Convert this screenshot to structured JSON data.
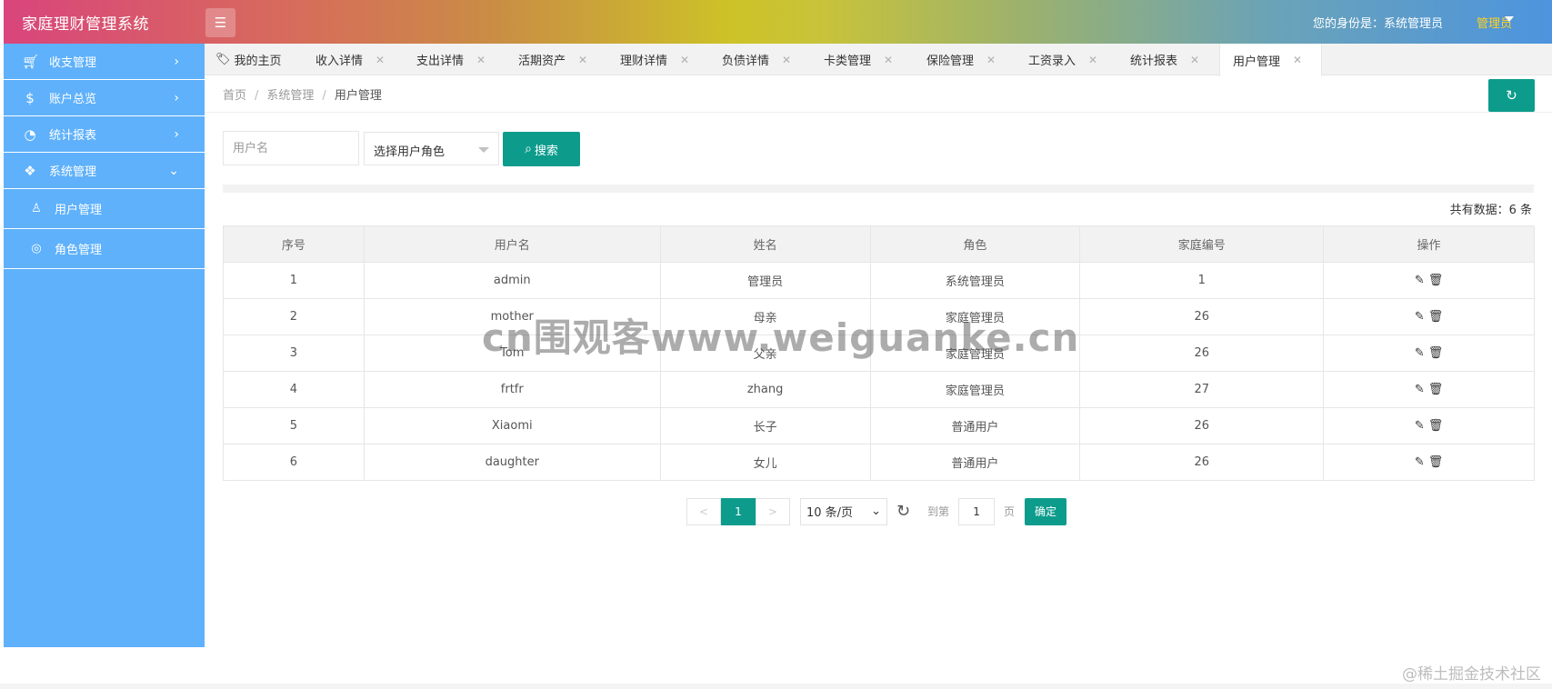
{
  "header": {
    "app_title": "家庭理财管理系统",
    "identity_text": "您的身份是：系统管理员",
    "role_label": "管理员"
  },
  "sidebar": {
    "items": [
      {
        "label": "收支管理",
        "icon": "cart-icon",
        "expanded": false
      },
      {
        "label": "账户总览",
        "icon": "dollar-icon",
        "expanded": false
      },
      {
        "label": "统计报表",
        "icon": "chart-line-icon",
        "expanded": false
      },
      {
        "label": "系统管理",
        "icon": "apps-icon",
        "expanded": true
      }
    ],
    "subitems": [
      {
        "label": "用户管理",
        "icon": "user-icon"
      },
      {
        "label": "角色管理",
        "icon": "user-circle-icon"
      }
    ]
  },
  "tabs": [
    {
      "label": "我的主页",
      "closable": false
    },
    {
      "label": "收入详情",
      "closable": true
    },
    {
      "label": "支出详情",
      "closable": true
    },
    {
      "label": "活期资产",
      "closable": true
    },
    {
      "label": "理财详情",
      "closable": true
    },
    {
      "label": "负债详情",
      "closable": true
    },
    {
      "label": "卡类管理",
      "closable": true
    },
    {
      "label": "保险管理",
      "closable": true
    },
    {
      "label": "工资录入",
      "closable": true
    },
    {
      "label": "统计报表",
      "closable": true
    },
    {
      "label": "用户管理",
      "closable": true,
      "active": true
    }
  ],
  "tab_close_glyph": "✕",
  "breadcrumb": {
    "items": [
      "首页",
      "系统管理",
      "用户管理"
    ],
    "separator": "/"
  },
  "search": {
    "username_placeholder": "用户名",
    "role_select_label": "选择用户角色",
    "search_label": "搜索"
  },
  "total_text": "共有数据：6 条",
  "table": {
    "headers": [
      "序号",
      "用户名",
      "姓名",
      "角色",
      "家庭编号",
      "操作"
    ],
    "rows": [
      [
        "1",
        "admin",
        "管理员",
        "系统管理员",
        "1"
      ],
      [
        "2",
        "mother",
        "母亲",
        "家庭管理员",
        "26"
      ],
      [
        "3",
        "Tom",
        "父亲",
        "家庭管理员",
        "26"
      ],
      [
        "4",
        "frtfr",
        "zhang",
        "家庭管理员",
        "27"
      ],
      [
        "5",
        "Xiaomi",
        "长子",
        "普通用户",
        "26"
      ],
      [
        "6",
        "daughter",
        "女儿",
        "普通用户",
        "26"
      ]
    ]
  },
  "pagination": {
    "prev_label": "<",
    "current_page": "1",
    "next_label": ">",
    "page_size": "10 条/页",
    "goto_label": "到第",
    "goto_value": "1",
    "page_unit": "页",
    "confirm_label": "确定"
  },
  "overlays": {
    "watermark": "cn围观客www.weiguanke.cn",
    "corner_mark": "@稀土掘金技术社区"
  },
  "colors": {
    "accent": "#0d9c8c",
    "sidebar": "#5fb1fb",
    "role_link": "#ffd21f"
  }
}
